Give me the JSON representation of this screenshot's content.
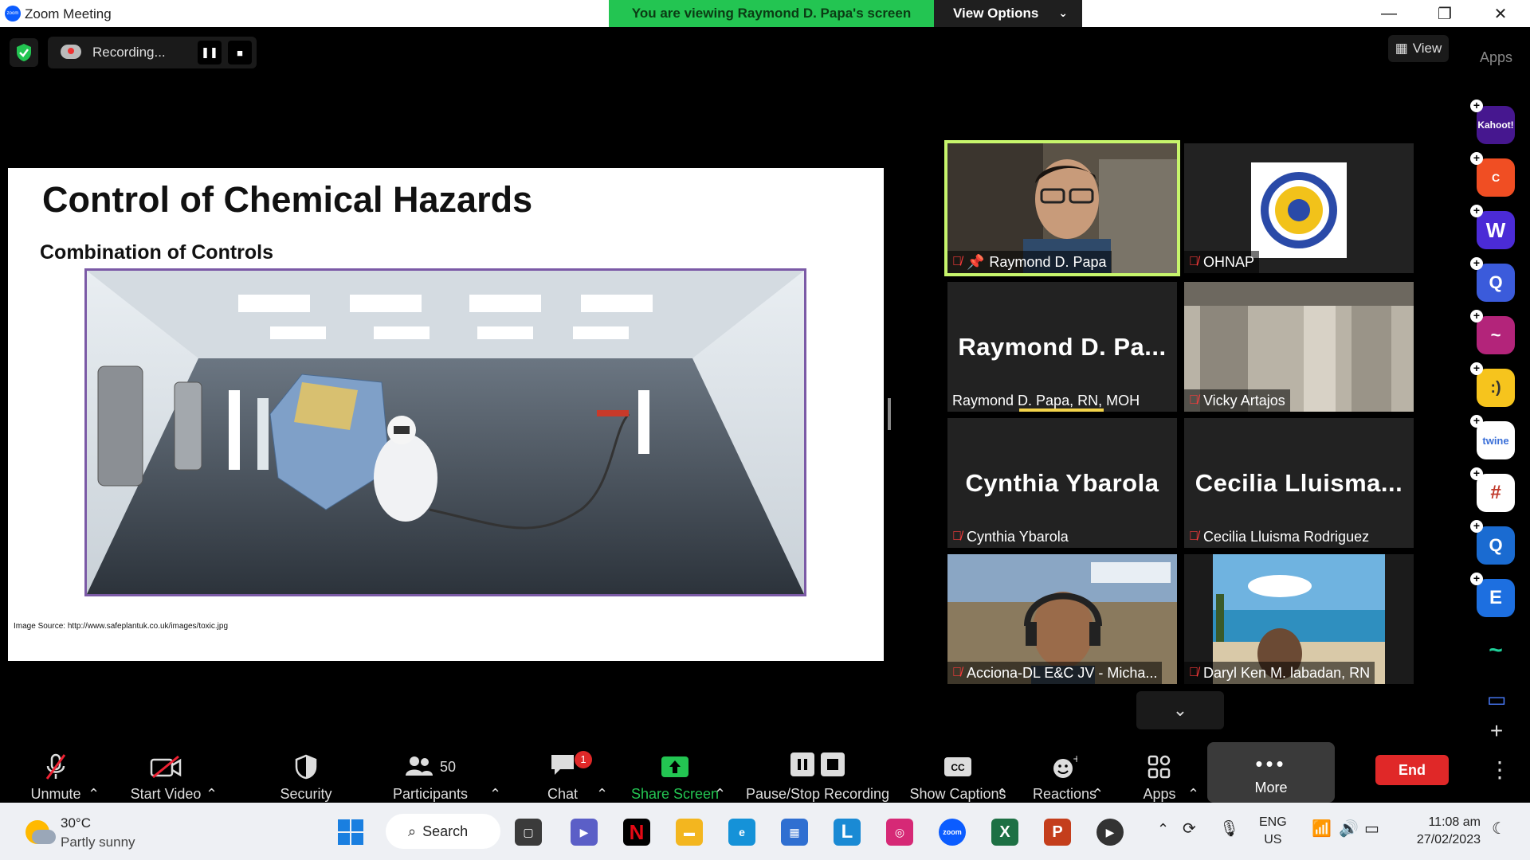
{
  "window": {
    "title": "Zoom Meeting",
    "banner": "You are viewing Raymond D. Papa's screen",
    "view_options": "View Options"
  },
  "topbar": {
    "recording_label": "Recording...",
    "view_label": "View",
    "apps_label": "Apps"
  },
  "slide": {
    "title": "Control of Chemical Hazards",
    "subtitle": "Combination of Controls",
    "source": "Image Source:  http://www.safeplantuk.co.uk/images/toxic.jpg"
  },
  "gallery": {
    "tiles": [
      {
        "name": "Raymond D. Papa",
        "big": ""
      },
      {
        "name": "OHNAP",
        "big": ""
      },
      {
        "name": "Raymond D. Papa, RN, MOH",
        "big": "Raymond  D.  Pa..."
      },
      {
        "name": "Vicky Artajos",
        "big": ""
      },
      {
        "name": "Cynthia Ybarola",
        "big": "Cynthia Ybarola"
      },
      {
        "name": "Cecilia Lluisma Rodriguez",
        "big": "Cecilia  Lluisma..."
      },
      {
        "name": "Acciona-DL E&C JV - Micha...",
        "big": ""
      },
      {
        "name": "Daryl Ken M. labadan, RN",
        "big": ""
      }
    ]
  },
  "sidebar_apps": [
    "Kahoot!",
    "C",
    "W",
    "Q",
    "~",
    ":)",
    "twine",
    "#",
    "Q",
    "E",
    "~"
  ],
  "controls": {
    "unmute": "Unmute",
    "start_video": "Start Video",
    "security": "Security",
    "participants": "Participants",
    "participants_count": "50",
    "chat": "Chat",
    "chat_badge": "1",
    "share_screen": "Share Screen",
    "pause_stop_recording": "Pause/Stop Recording",
    "show_captions": "Show Captions",
    "reactions": "Reactions",
    "apps": "Apps",
    "more": "More",
    "end": "End"
  },
  "taskbar": {
    "temp": "30°C",
    "condition": "Partly sunny",
    "search": "Search",
    "lang1": "ENG",
    "lang2": "US",
    "time": "11:08 am",
    "date": "27/02/2023"
  },
  "colors": {
    "banner_green": "#23c552",
    "active_speaker": "#c7f56c",
    "end_red": "#e02828",
    "slide_frame": "#7b5aa6"
  }
}
